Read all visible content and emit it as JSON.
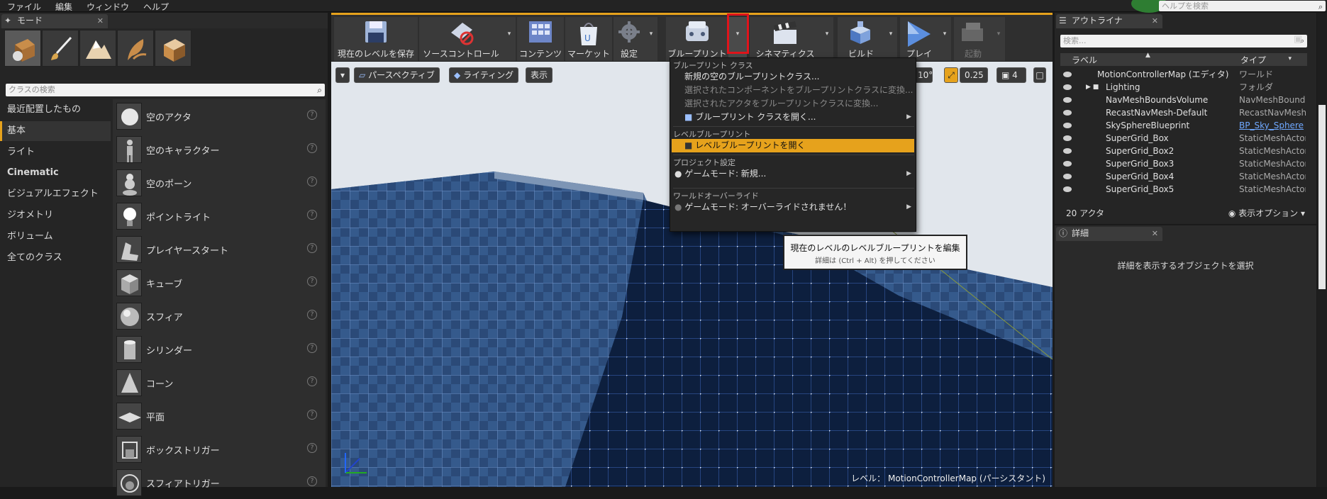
{
  "menubar": {
    "items": [
      "ファイル",
      "編集",
      "ウィンドウ",
      "ヘルプ"
    ],
    "help_search_placeholder": "ヘルプを検索"
  },
  "modes_panel": {
    "tab_label": "モード",
    "mode_buttons": [
      "place-mode",
      "paint-mode",
      "landscape-mode",
      "foliage-mode",
      "geometry-mode"
    ],
    "search_placeholder": "クラスの検索",
    "categories": [
      "最近配置したもの",
      "基本",
      "ライト",
      "Cinematic",
      "ビジュアルエフェクト",
      "ジオメトリ",
      "ボリューム",
      "全てのクラス"
    ],
    "active_category": "基本",
    "items": [
      "空のアクタ",
      "空のキャラクター",
      "空のポーン",
      "ポイントライト",
      "プレイヤースタート",
      "キューブ",
      "スフィア",
      "シリンダー",
      "コーン",
      "平面",
      "ボックストリガー",
      "スフィアトリガー"
    ]
  },
  "toolbar": {
    "save": "現在のレベルを保存",
    "source_control": "ソースコントロール",
    "content": "コンテンツ",
    "market": "マーケット",
    "settings": "設定",
    "blueprint": "ブループリント",
    "cinematics": "シネマティクス",
    "build": "ビルド",
    "play": "プレイ",
    "launch": "起動"
  },
  "viewport": {
    "perspective": "パースペクティブ",
    "lighting": "ライティング",
    "show": "表示",
    "rotation_snap": "10°",
    "scale_snap": "0.25",
    "camera_speed": "4",
    "level_label": "レベル：",
    "level_name": "MotionControllerMap (パーシスタント)"
  },
  "blueprint_menu": {
    "sec_classes": "ブループリント クラス",
    "new_empty": "新規の空のブループリントクラス...",
    "convert_component": "選択されたコンポーネントをブループリントクラスに変換...",
    "convert_actor": "選択されたアクタをブループリントクラスに変換...",
    "open_class": "ブループリント クラスを開く...",
    "sec_level": "レベルブループリント",
    "open_level": "レベルブループリントを開く",
    "sec_project": "プロジェクト設定",
    "game_mode_new": "ゲームモード: 新規...",
    "sec_world": "ワールドオーバーライド",
    "game_mode_override": "ゲームモード: オーバーライドされません！"
  },
  "tooltip": {
    "title": "現在のレベルのレベルブループリントを編集",
    "hint": "詳細は (Ctrl + Alt) を押してください"
  },
  "outliner": {
    "tab_label": "アウトライナ",
    "search_placeholder": "検索...",
    "col_label": "ラベル",
    "col_type": "タイプ",
    "rows": [
      {
        "name": "MotionControllerMap (エディタ)",
        "type": "ワールド"
      },
      {
        "name": "Lighting",
        "type": "フォルダ"
      },
      {
        "name": "NavMeshBoundsVolume",
        "type": "NavMeshBounds"
      },
      {
        "name": "RecastNavMesh-Default",
        "type": "RecastNavMesh"
      },
      {
        "name": "SkySphereBlueprint",
        "type": "BP_Sky_Sphere"
      },
      {
        "name": "SuperGrid_Box",
        "type": "StaticMeshActor"
      },
      {
        "name": "SuperGrid_Box2",
        "type": "StaticMeshActor"
      },
      {
        "name": "SuperGrid_Box3",
        "type": "StaticMeshActor"
      },
      {
        "name": "SuperGrid_Box4",
        "type": "StaticMeshActor"
      },
      {
        "name": "SuperGrid_Box5",
        "type": "StaticMeshActor"
      }
    ],
    "actor_count": "20 アクタ",
    "view_options": "表示オプション"
  },
  "details": {
    "tab_label": "詳細",
    "message": "詳細を表示するオブジェクトを選択"
  },
  "colors": {
    "accent": "#e6a21c",
    "highlight_box": "#e0141b",
    "link": "#6fa8ff"
  }
}
